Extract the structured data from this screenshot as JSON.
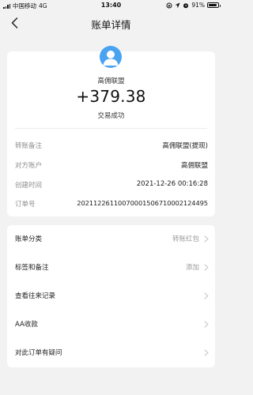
{
  "status_bar": {
    "carrier": "中国移动",
    "network": "4G",
    "time": "13:40",
    "battery": "91%",
    "battery_level": 0.91
  },
  "nav": {
    "title": "账单详情"
  },
  "summary": {
    "merchant": "高佣联盟",
    "amount": "+379.38",
    "status": "交易成功",
    "avatar_color": "#49a3f1"
  },
  "details": [
    {
      "label": "转账备注",
      "value": "高佣联盟(提现)"
    },
    {
      "label": "对方账户",
      "value": "高佣联盟"
    },
    {
      "label": "创建时间",
      "value": "2021-12-26 00:16:28"
    },
    {
      "label": "订单号",
      "value": "20211226110070001506710002124495"
    }
  ],
  "actions": [
    {
      "label": "账单分类",
      "value": "转账红包"
    },
    {
      "label": "标签和备注",
      "value": "添加"
    },
    {
      "label": "查看往来记录",
      "value": ""
    },
    {
      "label": "AA收款",
      "value": ""
    },
    {
      "label": "对此订单有疑问",
      "value": ""
    }
  ]
}
